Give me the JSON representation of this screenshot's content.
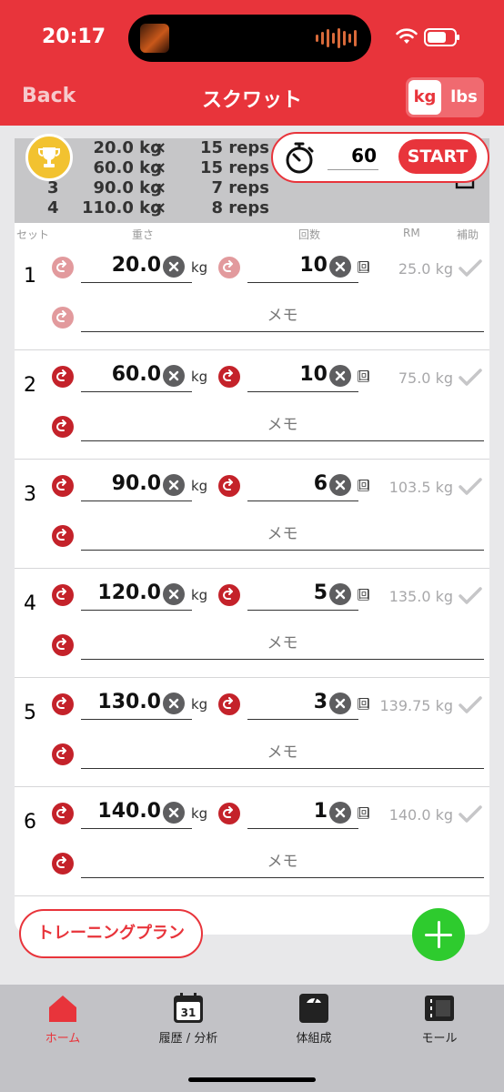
{
  "status_bar": {
    "time": "20:17"
  },
  "nav": {
    "back": "Back",
    "title": "スクワット",
    "unit_kg": "kg",
    "unit_lbs": "lbs"
  },
  "previous": {
    "rows": [
      {
        "num": "",
        "weight": "20.0 kg",
        "x": "×",
        "reps": "15 reps"
      },
      {
        "num": "",
        "weight": "60.0 kg",
        "x": "×",
        "reps": "15 reps"
      },
      {
        "num": "3",
        "weight": "90.0 kg",
        "x": "×",
        "reps": "7 reps"
      },
      {
        "num": "4",
        "weight": "110.0 kg",
        "x": "×",
        "reps": "8 reps"
      }
    ]
  },
  "timer": {
    "value": "60",
    "start": "START"
  },
  "columns": {
    "set": "セット",
    "weight": "重さ",
    "reps": "回数",
    "rm": "RM",
    "assist": "補助"
  },
  "sets": [
    {
      "num": "1",
      "weight": "20.0",
      "unit": "kg",
      "reps": "10",
      "rep_unit": "回",
      "rm": "25.0 kg",
      "memo": "メモ"
    },
    {
      "num": "2",
      "weight": "60.0",
      "unit": "kg",
      "reps": "10",
      "rep_unit": "回",
      "rm": "75.0 kg",
      "memo": "メモ"
    },
    {
      "num": "3",
      "weight": "90.0",
      "unit": "kg",
      "reps": "6",
      "rep_unit": "回",
      "rm": "103.5 kg",
      "memo": "メモ"
    },
    {
      "num": "4",
      "weight": "120.0",
      "unit": "kg",
      "reps": "5",
      "rep_unit": "回",
      "rm": "135.0 kg",
      "memo": "メモ"
    },
    {
      "num": "5",
      "weight": "130.0",
      "unit": "kg",
      "reps": "3",
      "rep_unit": "回",
      "rm": "139.75 kg",
      "memo": "メモ"
    },
    {
      "num": "6",
      "weight": "140.0",
      "unit": "kg",
      "reps": "1",
      "rep_unit": "回",
      "rm": "140.0 kg",
      "memo": "メモ"
    }
  ],
  "plan_button": "トレーニングプラン",
  "tabs": [
    {
      "label": "ホーム",
      "icon": "home-icon"
    },
    {
      "label": "履歴 / 分析",
      "icon": "calendar-icon",
      "badge": "31"
    },
    {
      "label": "体組成",
      "icon": "scale-icon"
    },
    {
      "label": "モール",
      "icon": "store-icon"
    }
  ],
  "colors": {
    "accent": "#e8343b",
    "add": "#2ecb2e",
    "tabbar": "#c2c2c6"
  }
}
